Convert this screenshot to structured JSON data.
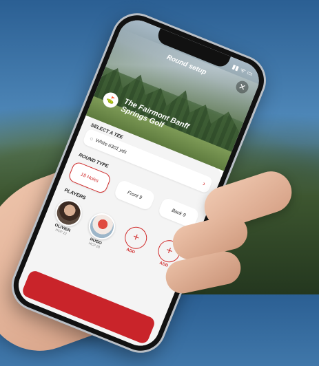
{
  "header": {
    "title": "Round setup",
    "close_icon": "close-icon"
  },
  "course": {
    "name": "The Fairmont Banff Springs Golf"
  },
  "tee": {
    "section_label": "SELECT A TEE",
    "value": "White 6301 yds",
    "chevron_icon": "chevron-right-icon"
  },
  "round_type": {
    "section_label": "ROUND TYPE",
    "options": [
      {
        "label": "18 Holes",
        "selected": true
      },
      {
        "label": "Front 9",
        "selected": false
      },
      {
        "label": "Back 9",
        "selected": false
      }
    ]
  },
  "players": {
    "section_label": "PLAYERS",
    "list": [
      {
        "name": "OLIVIER",
        "hcp": "HCP 12"
      },
      {
        "name": "HUGO",
        "hcp": "HCP 28"
      }
    ],
    "add_label": "ADD"
  },
  "colors": {
    "accent": "#d12c2c"
  }
}
